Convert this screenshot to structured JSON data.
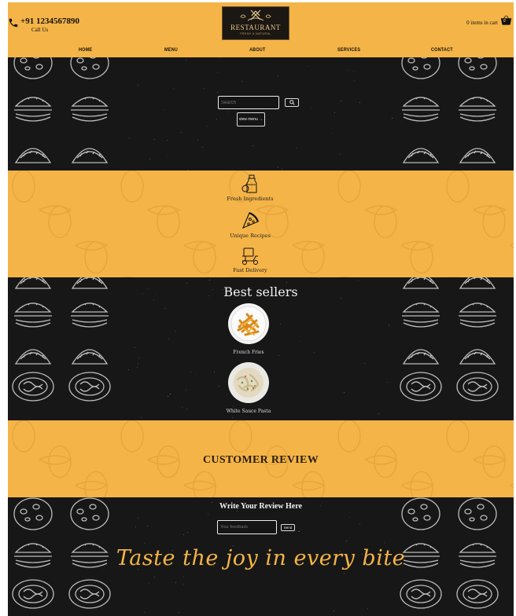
{
  "header": {
    "phone_number": "+91 1234567890",
    "phone_caption": "Call Us",
    "logo_title": "RESTAURANT",
    "logo_tagline": "FRESH & NATURAL",
    "cart_text": "0 items in cart",
    "cart_count": "0",
    "brand_color": "#f4b447"
  },
  "nav": {
    "items": [
      {
        "label": "HOME"
      },
      {
        "label": "MENU"
      },
      {
        "label": "ABOUT"
      },
      {
        "label": "SERVICES"
      },
      {
        "label": "CONTACT"
      }
    ]
  },
  "hero": {
    "search_placeholder": "Search",
    "search_icon": "search-icon",
    "view_menu_label": "view menu →"
  },
  "features": [
    {
      "label": "Fresh Ingredients",
      "icon": "ingredients-icon"
    },
    {
      "label": "Unique Recipes",
      "icon": "pizza-slice-icon"
    },
    {
      "label": "Fast Delivery",
      "icon": "delivery-scooter-icon"
    }
  ],
  "best_sellers": {
    "title": "Best sellers",
    "items": [
      {
        "name": "French Fries"
      },
      {
        "name": "White Sauce Pasta"
      }
    ]
  },
  "reviews": {
    "title": "CUSTOMER REVIEW",
    "write_title": "Write Your Review Here",
    "feedback_placeholder": "Your feedback",
    "send_label": "Send"
  },
  "tagline": "Taste the joy in every bite"
}
